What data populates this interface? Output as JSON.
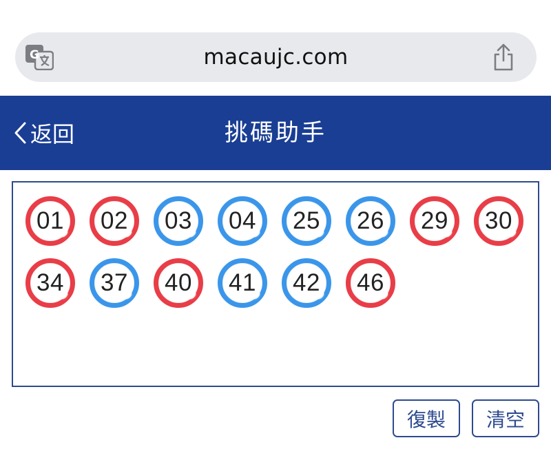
{
  "browser": {
    "url": "macaujc.com",
    "icons": {
      "translate": "translate-icon",
      "share": "share-icon"
    }
  },
  "header": {
    "back_label": "返回",
    "title": "挑碼助手",
    "background": "#1a3e94"
  },
  "numbers": [
    {
      "value": "01",
      "color": "red"
    },
    {
      "value": "02",
      "color": "red"
    },
    {
      "value": "03",
      "color": "blue"
    },
    {
      "value": "04",
      "color": "blue"
    },
    {
      "value": "25",
      "color": "blue"
    },
    {
      "value": "26",
      "color": "blue"
    },
    {
      "value": "29",
      "color": "red"
    },
    {
      "value": "30",
      "color": "red"
    },
    {
      "value": "34",
      "color": "red"
    },
    {
      "value": "37",
      "color": "blue"
    },
    {
      "value": "40",
      "color": "red"
    },
    {
      "value": "41",
      "color": "blue"
    },
    {
      "value": "42",
      "color": "blue"
    },
    {
      "value": "46",
      "color": "red"
    }
  ],
  "colors": {
    "red": "#e93d47",
    "blue": "#3a96ea",
    "accent": "#2c4a8e"
  },
  "actions": {
    "copy_label": "復製",
    "clear_label": "清空"
  }
}
